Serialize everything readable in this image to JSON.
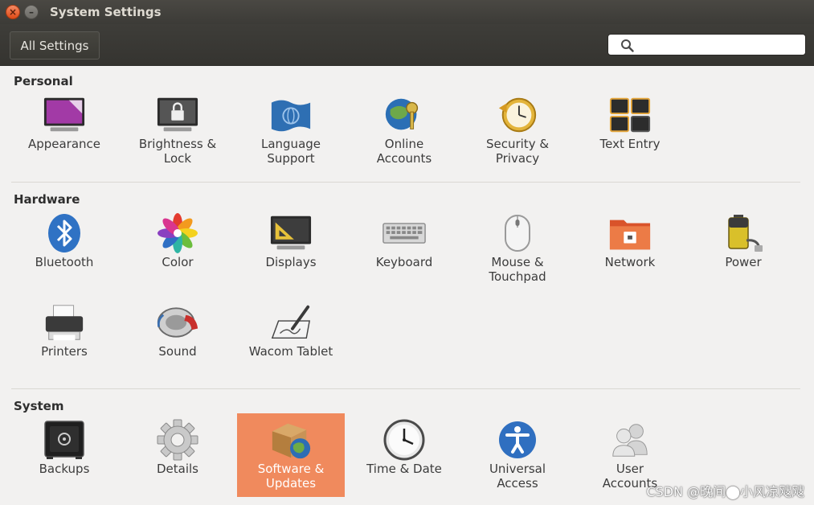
{
  "window": {
    "title": "System Settings"
  },
  "toolbar": {
    "all_settings_label": "All Settings",
    "search_placeholder": ""
  },
  "sections": {
    "personal": {
      "title": "Personal",
      "items": [
        {
          "label": "Appearance",
          "icon": "appearance-icon"
        },
        {
          "label": "Brightness &\nLock",
          "icon": "brightness-lock-icon"
        },
        {
          "label": "Language\nSupport",
          "icon": "language-support-icon"
        },
        {
          "label": "Online\nAccounts",
          "icon": "online-accounts-icon"
        },
        {
          "label": "Security &\nPrivacy",
          "icon": "security-privacy-icon"
        },
        {
          "label": "Text Entry",
          "icon": "text-entry-icon"
        }
      ]
    },
    "hardware": {
      "title": "Hardware",
      "items": [
        {
          "label": "Bluetooth",
          "icon": "bluetooth-icon"
        },
        {
          "label": "Color",
          "icon": "color-icon"
        },
        {
          "label": "Displays",
          "icon": "displays-icon"
        },
        {
          "label": "Keyboard",
          "icon": "keyboard-icon"
        },
        {
          "label": "Mouse &\nTouchpad",
          "icon": "mouse-icon"
        },
        {
          "label": "Network",
          "icon": "network-icon"
        },
        {
          "label": "Power",
          "icon": "power-icon"
        },
        {
          "label": "Printers",
          "icon": "printer-icon"
        },
        {
          "label": "Sound",
          "icon": "sound-icon"
        },
        {
          "label": "Wacom Tablet",
          "icon": "wacom-tablet-icon"
        }
      ]
    },
    "system": {
      "title": "System",
      "items": [
        {
          "label": "Backups",
          "icon": "backups-icon"
        },
        {
          "label": "Details",
          "icon": "details-icon"
        },
        {
          "label": "Software &\nUpdates",
          "icon": "software-updates-icon",
          "selected": true
        },
        {
          "label": "Time & Date",
          "icon": "clock-icon"
        },
        {
          "label": "Universal\nAccess",
          "icon": "universal-access-icon"
        },
        {
          "label": "User\nAccounts",
          "icon": "user-accounts-icon"
        }
      ]
    }
  },
  "watermark": "CSDN @晚间⬤小风凉飕飕",
  "colors": {
    "selection": "#f08a5d",
    "titlebar": "#3c3b37",
    "background": "#f2f1f0",
    "close_button": "#df4a16"
  }
}
